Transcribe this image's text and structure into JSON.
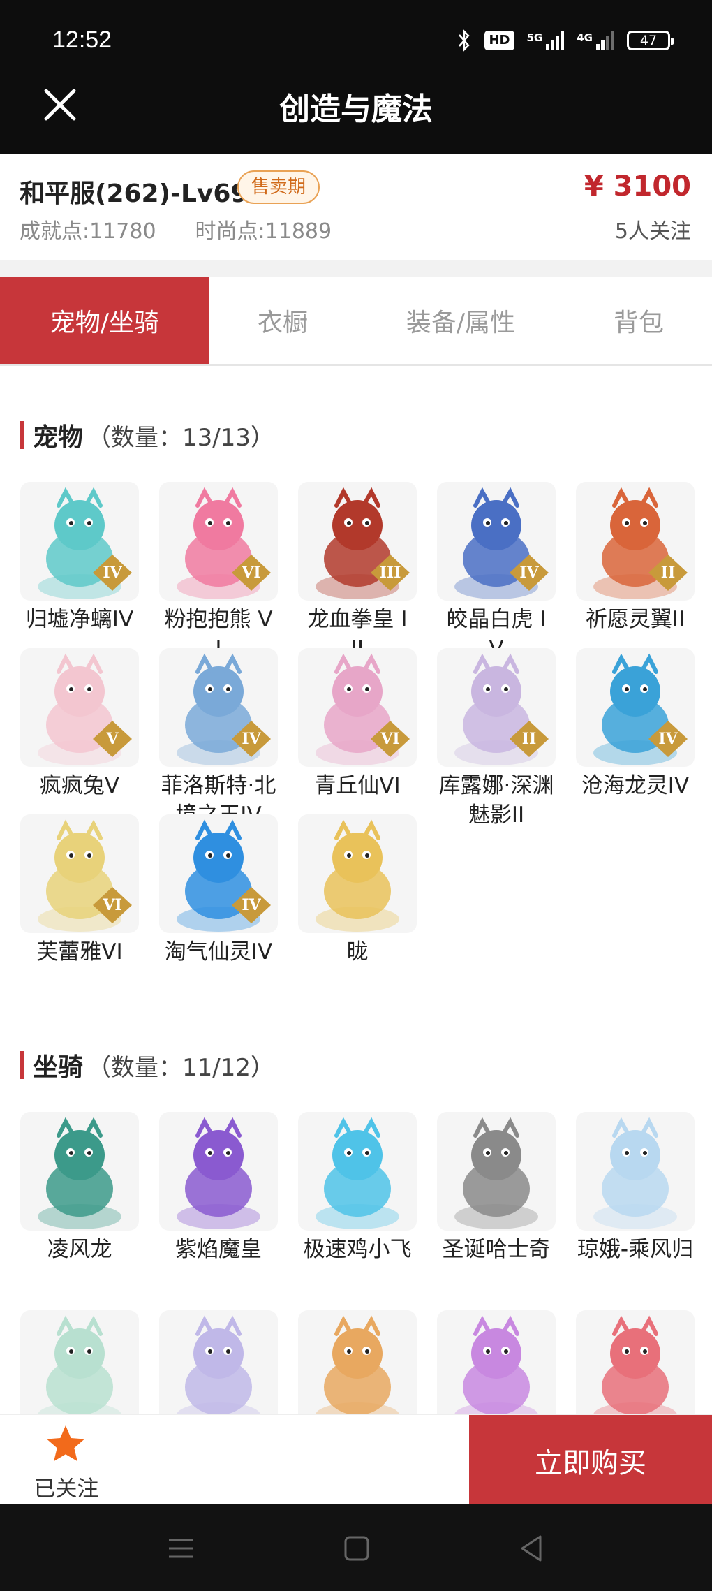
{
  "status_bar": {
    "time": "12:52",
    "hd_label": "HD",
    "net1_label": "5G",
    "net2_label": "4G",
    "battery": "47"
  },
  "header": {
    "title": "创造与魔法",
    "close_icon": "close-icon"
  },
  "summary": {
    "server": "和平服(262)-Lv69",
    "sale_tag": "售卖期",
    "price": "¥ 3100",
    "achievement": "成就点:11780",
    "fashion": "时尚点:11889",
    "followers": "5人关注"
  },
  "tabs": [
    {
      "label": "宠物/坐骑",
      "active": true
    },
    {
      "label": "衣橱",
      "active": false
    },
    {
      "label": "装备/属性",
      "active": false
    },
    {
      "label": "背包",
      "active": false
    }
  ],
  "pets": {
    "title": "宠物",
    "count": "（数量：13/13）",
    "items": [
      {
        "name": "归墟净螭IV",
        "rank": "IV",
        "color": "#5ec9c9"
      },
      {
        "name": "粉抱抱熊 VI",
        "rank": "VI",
        "color": "#f07aa0"
      },
      {
        "name": "龙血拳皇 III",
        "rank": "III",
        "color": "#b2392b"
      },
      {
        "name": "皎晶白虎 IV",
        "rank": "IV",
        "color": "#4a6fc4"
      },
      {
        "name": "祈愿灵翼II",
        "rank": "II",
        "color": "#d9653a"
      },
      {
        "name": "疯疯兔V",
        "rank": "V",
        "color": "#f3c6d0"
      },
      {
        "name": "菲洛斯特·北境之王IV",
        "rank": "IV",
        "color": "#7aa9d8"
      },
      {
        "name": "青丘仙VI",
        "rank": "VI",
        "color": "#e7a6c8"
      },
      {
        "name": "库露娜·深渊魅影II",
        "rank": "II",
        "color": "#c9b6e0"
      },
      {
        "name": "沧海龙灵IV",
        "rank": "IV",
        "color": "#3aa2d8"
      },
      {
        "name": "芙蕾雅VI",
        "rank": "VI",
        "color": "#e8d27a"
      },
      {
        "name": "淘气仙灵IV",
        "rank": "IV",
        "color": "#2f8fe0"
      },
      {
        "name": "昽",
        "rank": "",
        "color": "#e9c25a"
      }
    ]
  },
  "mounts": {
    "title": "坐骑",
    "count": "（数量：11/12）",
    "items": [
      {
        "name": "凌风龙",
        "color": "#3c9a8a"
      },
      {
        "name": "紫焰魔皇",
        "color": "#8a5ad0"
      },
      {
        "name": "极速鸡小飞",
        "color": "#4fc3e8"
      },
      {
        "name": "圣诞哈士奇",
        "color": "#8a8a8a"
      },
      {
        "name": "琼娥-乘风归",
        "color": "#b8d8f0"
      },
      {
        "name": "",
        "color": "#b8e0d0"
      },
      {
        "name": "",
        "color": "#c0b8e8"
      },
      {
        "name": "",
        "color": "#e8a860"
      },
      {
        "name": "",
        "color": "#c888e0"
      },
      {
        "name": "",
        "color": "#e8707a"
      }
    ]
  },
  "actions": {
    "follow_label": "已关注",
    "buy_label": "立即购买",
    "star_color": "#f26a1b"
  },
  "nav": {
    "menu_icon": "menu-icon",
    "home_icon": "home-icon",
    "back_icon": "back-icon"
  }
}
